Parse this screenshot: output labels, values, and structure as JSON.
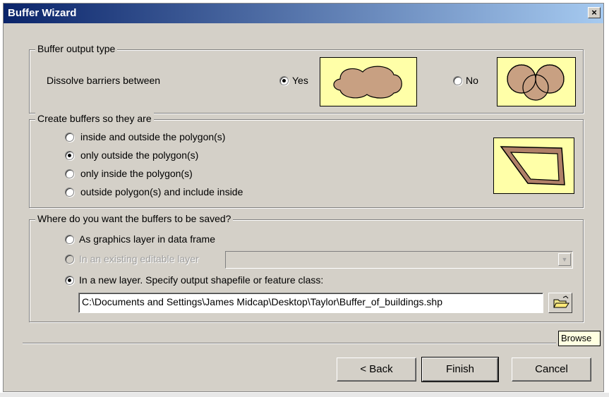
{
  "window": {
    "title": "Buffer Wizard",
    "close_glyph": "×"
  },
  "group_output": {
    "legend": "Buffer output type",
    "label": "Dissolve barriers between",
    "yes_label": "Yes",
    "no_label": "No",
    "selected": "yes"
  },
  "group_create": {
    "legend": "Create buffers so they are",
    "options": [
      "inside and outside the polygon(s)",
      "only outside the polygon(s)",
      "only inside the polygon(s)",
      "outside polygon(s) and include inside"
    ],
    "selected_index": 1
  },
  "group_save": {
    "legend": "Where do you want the buffers to be saved?",
    "option_graphics": "As graphics layer in data frame",
    "option_existing": "In an existing editable layer",
    "option_new": "In a new layer.  Specify output shapefile or feature class:",
    "selected": "new",
    "existing_layer_value": "",
    "output_path": "C:\\Documents and Settings\\James Midcap\\Desktop\\Taylor\\Buffer_of_buildings.shp",
    "browse_tooltip": "Browse",
    "browse_icon": "open-folder-icon"
  },
  "buttons": {
    "back": "< Back",
    "finish": "Finish",
    "cancel": "Cancel"
  },
  "colors": {
    "dialog": "#d4d0c8",
    "preview_bg": "#ffffa8",
    "shape_fill": "#c8a082",
    "title_bar": "#0a246a"
  }
}
